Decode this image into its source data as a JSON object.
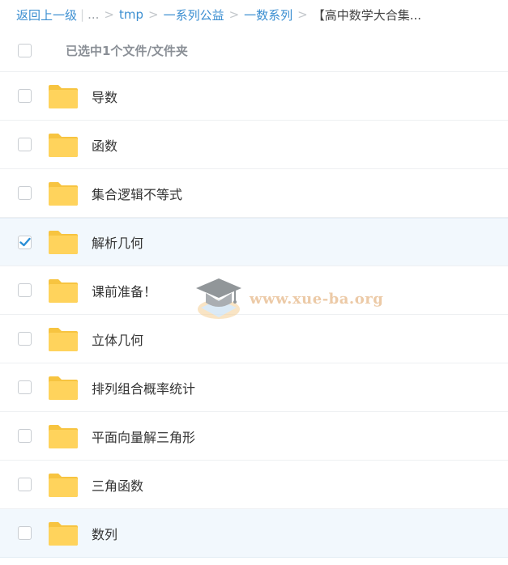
{
  "breadcrumb": {
    "back": "返回上一级",
    "ellipsis": "...",
    "pipe": "|",
    "sep": ">",
    "items": [
      "tmp",
      "一系列公益",
      "一数系列"
    ],
    "current": "【高中数学大合集..."
  },
  "selection": {
    "text": "已选中1个文件/文件夹"
  },
  "files": [
    {
      "name": "导数",
      "checked": false
    },
    {
      "name": "函数",
      "checked": false
    },
    {
      "name": "集合逻辑不等式",
      "checked": false
    },
    {
      "name": "解析几何",
      "checked": true
    },
    {
      "name": "课前准备！",
      "checked": false
    },
    {
      "name": "立体几何",
      "checked": false
    },
    {
      "name": "排列组合概率统计",
      "checked": false
    },
    {
      "name": "平面向量解三角形",
      "checked": false
    },
    {
      "name": "三角函数",
      "checked": false
    },
    {
      "name": "数列",
      "checked": false
    }
  ],
  "watermark": {
    "text": "www.xue-ba.org"
  },
  "colors": {
    "link": "#3c8fd1",
    "folder": "#ffd35c",
    "check": "#2b8fd6"
  }
}
